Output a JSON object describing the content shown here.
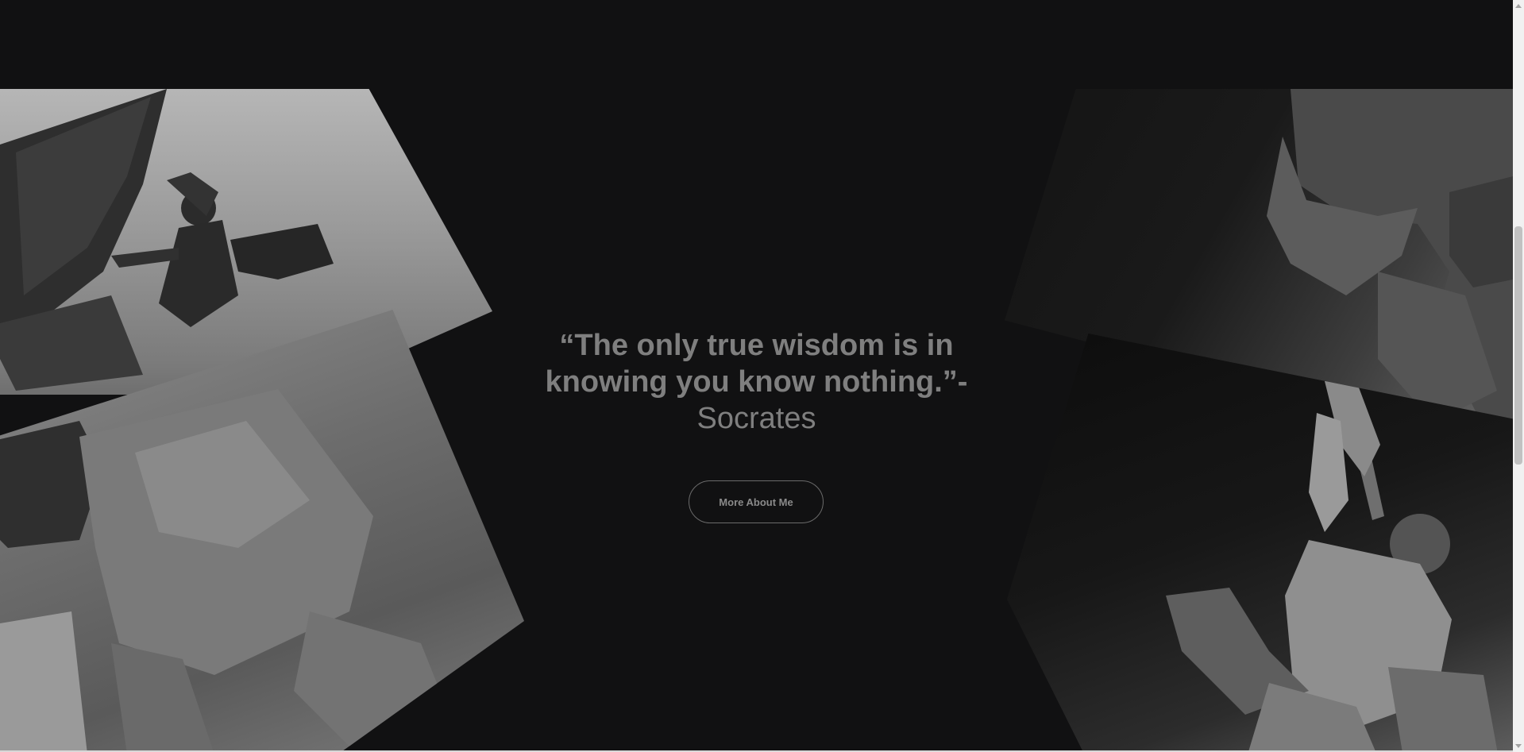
{
  "quote": {
    "text": "“The only true wisdom is in knowing you know nothing.”-",
    "author": "Socrates"
  },
  "cta": {
    "label": "More About Me"
  },
  "images": {
    "left_top": "winged-statue-photo",
    "left_bottom": "muscular-back-statue-photo",
    "right_top": "bearded-statue-photo",
    "right_bottom": "sword-warrior-statue-photo"
  },
  "colors": {
    "background": "#111112",
    "text": "#7f7f7f",
    "button_border": "#6b6b6b"
  }
}
